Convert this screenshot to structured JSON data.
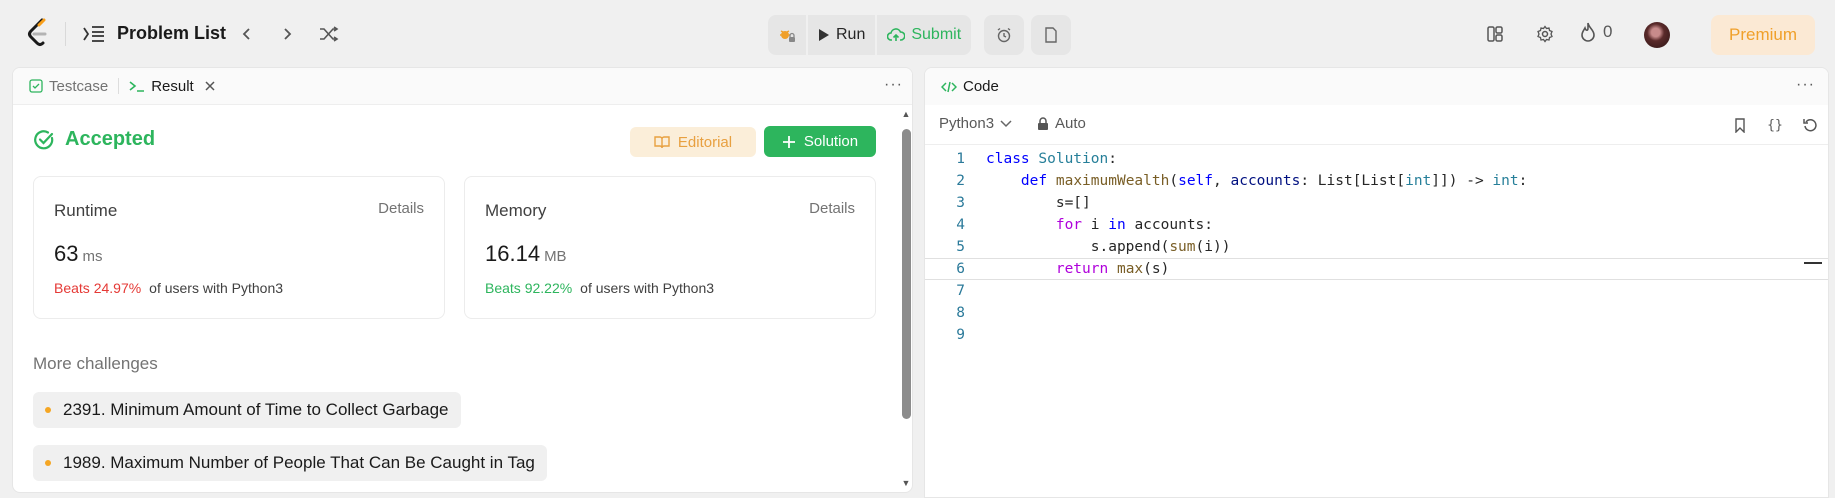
{
  "nav": {
    "title": "Problem List",
    "run_label": "Run",
    "submit_label": "Submit",
    "streak_count": "0",
    "premium_label": "Premium"
  },
  "left": {
    "tabs": [
      {
        "label": "Testcase"
      },
      {
        "label": "Result"
      }
    ],
    "status": "Accepted",
    "editorial_label": "Editorial",
    "solution_label": "Solution",
    "runtime": {
      "title": "Runtime",
      "details": "Details",
      "value": "63",
      "unit": "ms",
      "beats": "Beats 24.97%",
      "suffix": "of users with Python3"
    },
    "memory": {
      "title": "Memory",
      "details": "Details",
      "value": "16.14",
      "unit": "MB",
      "beats": "Beats 92.22%",
      "suffix": "of users with Python3"
    },
    "more_challenges": "More challenges",
    "challenges": [
      "2391. Minimum Amount of Time to Collect Garbage",
      "1989. Maximum Number of People That Can Be Caught in Tag"
    ]
  },
  "right": {
    "tab_label": "Code",
    "language": "Python3",
    "auto_label": "Auto",
    "line_numbers": [
      "1",
      "2",
      "3",
      "4",
      "5",
      "6",
      "7",
      "8",
      "9"
    ]
  },
  "colors": {
    "accepted": "#2db55d",
    "beats_bad": "#e53935",
    "premium": "#f0a02a"
  }
}
